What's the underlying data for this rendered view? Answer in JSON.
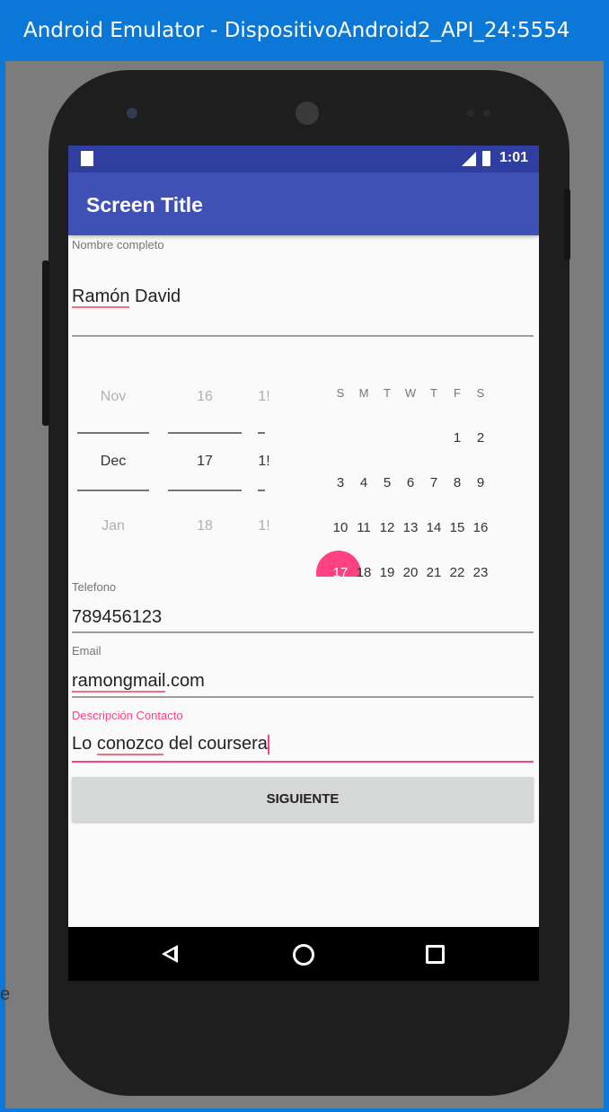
{
  "window": {
    "title": "Android Emulator - DispositivoAndroid2_API_24:5554"
  },
  "stray_text": "e",
  "status_bar": {
    "time": "1:01"
  },
  "app_bar": {
    "title": "Screen Title"
  },
  "form": {
    "nombre": {
      "label": "Nombre completo",
      "value_part1": "Ramón",
      "value_part2": " David"
    },
    "telefono": {
      "label": "Telefono",
      "value": "789456123"
    },
    "email": {
      "label": "Email",
      "value_part1": "ramongmail",
      "value_part2": ".com"
    },
    "descripcion": {
      "label": "Descripción Contacto",
      "part1": "Lo ",
      "part2": "conozco",
      "part3": " del coursera"
    },
    "button_label": "SIGUIENTE"
  },
  "date_spinner": {
    "months": [
      "Nov",
      "Dec",
      "Jan"
    ],
    "days": [
      "16",
      "17",
      "18"
    ],
    "years": [
      "1!",
      "1!",
      "1!"
    ]
  },
  "calendar": {
    "weekdays": [
      "S",
      "M",
      "T",
      "W",
      "T",
      "F",
      "S"
    ],
    "rows": [
      [
        "",
        "",
        "",
        "",
        "",
        "1",
        "2"
      ],
      [
        "3",
        "4",
        "5",
        "6",
        "7",
        "8",
        "9"
      ],
      [
        "10",
        "11",
        "12",
        "13",
        "14",
        "15",
        "16"
      ],
      [
        "17",
        "18",
        "19",
        "20",
        "21",
        "22",
        "23"
      ]
    ],
    "selected_day": "17",
    "accent_color": "#ff4081"
  },
  "colors": {
    "primary": "#3f51b5",
    "primary_dark": "#303f9f",
    "accent": "#ff4081",
    "window_title_bar": "#0b78d7"
  }
}
